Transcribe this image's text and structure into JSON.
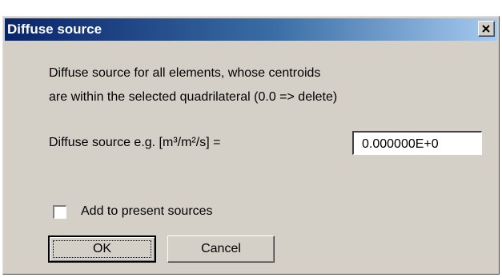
{
  "window": {
    "title": "Diffuse source"
  },
  "description": {
    "line1": "Diffuse source for all elements, whose centroids",
    "line2": "are within the selected quadrilateral (0.0 => delete)"
  },
  "field": {
    "label": "Diffuse source e.g. [m³/m²/s] =",
    "value": "0.000000E+0"
  },
  "checkbox": {
    "label": "Add to present sources",
    "checked": false
  },
  "buttons": {
    "ok_label": "OK",
    "cancel_label": "Cancel"
  },
  "colors": {
    "titlebar_start": "#0a246a",
    "titlebar_end": "#a6caf0",
    "dialog_bg": "#d4d0c8"
  },
  "icons": {
    "close": "close-icon"
  }
}
